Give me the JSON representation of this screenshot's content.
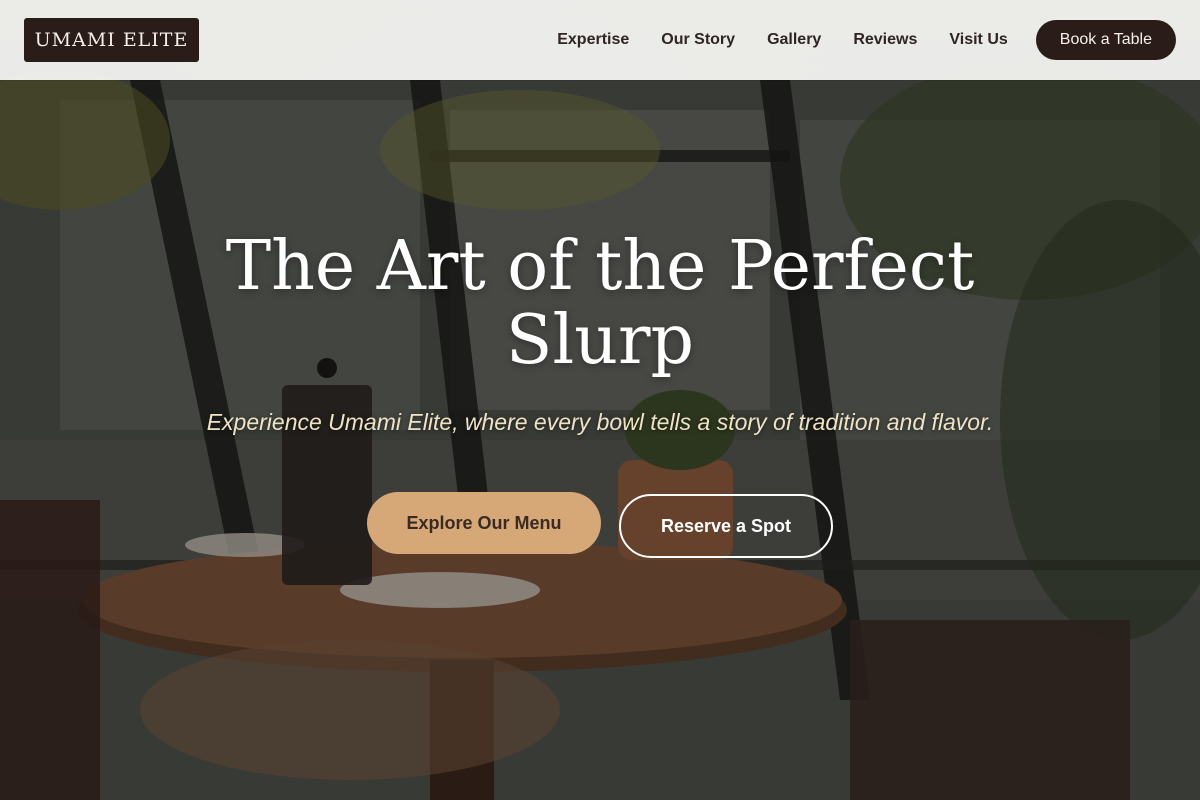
{
  "brand": {
    "name": "UMAMI ELITE"
  },
  "nav": {
    "links": [
      "Expertise",
      "Our Story",
      "Gallery",
      "Reviews",
      "Visit Us"
    ],
    "cta": "Book a Table"
  },
  "hero": {
    "title": "The Art of the Perfect Slurp",
    "subtitle": "Experience Umami Elite, where every bowl tells a story of tradition and flavor.",
    "primary_button": "Explore Our Menu",
    "secondary_button": "Reserve a Spot"
  },
  "colors": {
    "brand_dark": "#2a1c19",
    "accent": "#d6a878",
    "header_bg": "#f5f5f3"
  }
}
